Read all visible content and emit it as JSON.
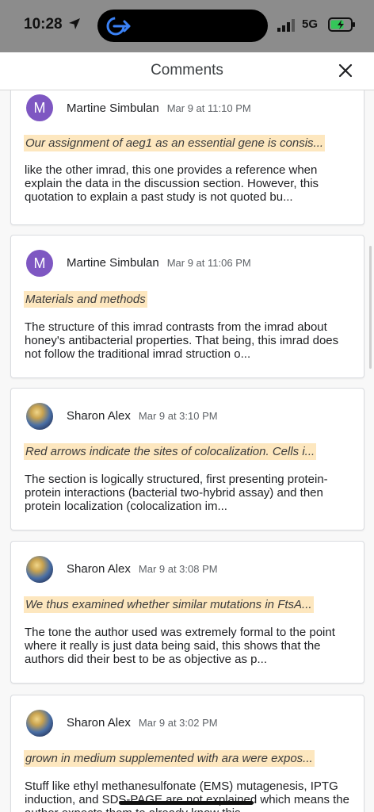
{
  "status_bar": {
    "time": "10:28",
    "network": "5G",
    "icons": [
      "location-arrow-icon",
      "app-switch-icon",
      "signal-icon",
      "battery-charging-icon"
    ]
  },
  "header": {
    "title": "Comments",
    "close_icon": "close-icon"
  },
  "comments": [
    {
      "author": "Martine Simbulan",
      "date": "Mar 9 at 11:10 PM",
      "avatar_initial": "M",
      "quote": "Our assignment of aeg1 as an essential gene is consis...",
      "body": "like the other imrad, this one provides a reference when explain the data in the discussion section. However, this quotation to explain a past study is not quoted bu..."
    },
    {
      "author": "Martine Simbulan",
      "date": "Mar 9 at 11:06 PM",
      "avatar_initial": "M",
      "quote": "Materials and methods",
      "body": "The structure of this imrad contrasts from the imrad about honey's antibacterial properties. That being, this imrad does not follow the traditional imrad struction o..."
    },
    {
      "author": "Sharon Alex",
      "date": "Mar 9 at 3:10 PM",
      "avatar_initial": "",
      "quote": "Red arrows indicate the sites of colocalization. Cells i...",
      "body": "The section is logically structured, first presenting protein-protein interactions (bacterial two-hybrid assay) and then protein localization (colocalization im..."
    },
    {
      "author": "Sharon Alex",
      "date": "Mar 9 at 3:08 PM",
      "avatar_initial": "",
      "quote": "We thus examined whether similar mutations in FtsA...",
      "body": "The tone the author used was extremely formal to the point where it really is just data being said, this shows that the authors did their best to be as objective as p..."
    },
    {
      "author": "Sharon Alex",
      "date": "Mar 9 at 3:02 PM",
      "avatar_initial": "",
      "quote": "grown in medium supplemented with ara were expos...",
      "body": "Stuff like ethyl methanesulfonate (EMS) mutagenesis, IPTG induction, and SDS-PAGE are not explained which means the author expects them to already know this"
    }
  ],
  "colors": {
    "status_bar_bg": "#8c8c8c",
    "avatar_purple": "#7e57c2",
    "quote_highlight": "#fde7bf",
    "card_border": "#dadce0"
  }
}
